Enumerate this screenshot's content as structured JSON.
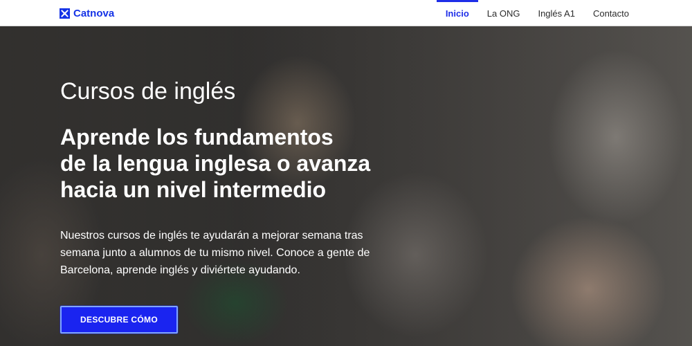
{
  "brand": {
    "name": "Catnova",
    "color": "#1432e6",
    "icon": "catnova-logo-icon"
  },
  "nav": {
    "items": [
      {
        "label": "Inicio",
        "active": true
      },
      {
        "label": "La ONG",
        "active": false
      },
      {
        "label": "Inglés A1",
        "active": false
      },
      {
        "label": "Contacto",
        "active": false
      }
    ],
    "active_color": "#1e2ee8"
  },
  "hero": {
    "eyebrow": "Cursos de inglés",
    "title_lines": [
      "Aprende los fundamentos",
      "de la lengua inglesa o avanza",
      "hacia un nivel intermedio"
    ],
    "description": "Nuestros cursos de inglés te ayudarán a mejorar semana tras semana junto a alumnos de tu mismo nivel. Conoce a gente de Barcelona, aprende inglés y diviértete ayudando.",
    "cta_label": "DESCUBRE CÓMO",
    "cta_color": "#1a24f0"
  }
}
